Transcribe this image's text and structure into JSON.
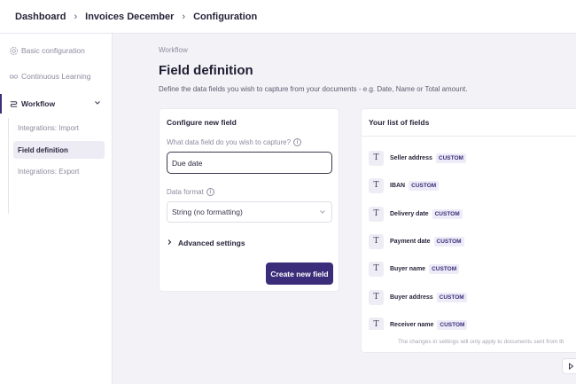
{
  "breadcrumb": [
    "Dashboard",
    "Invoices December",
    "Configuration"
  ],
  "sidebar": {
    "items": [
      {
        "label": "Basic configuration",
        "icon": "gear-icon"
      },
      {
        "label": "Continuous Learning",
        "icon": "infinity-icon"
      },
      {
        "label": "Workflow",
        "icon": "workflow-icon"
      }
    ],
    "subitems": [
      {
        "label": "Integrations: Import"
      },
      {
        "label": "Field definition",
        "active": true
      },
      {
        "label": "Integrations: Export"
      }
    ]
  },
  "main": {
    "section": "Workflow",
    "title": "Field definition",
    "description": "Define the data fields you wish to capture from your documents - e.g. Date, Name or Total amount."
  },
  "config": {
    "title": "Configure new field",
    "field_label": "What data field do you wish to capture?",
    "field_value": "Due date",
    "format_label": "Data format",
    "format_value": "String (no formatting)",
    "advanced": "Advanced settings",
    "create_button": "Create new field"
  },
  "fields_list": {
    "title": "Your list of fields",
    "badge": "CUSTOM",
    "items": [
      {
        "name": "Seller address",
        "type_icon": "T"
      },
      {
        "name": "IBAN",
        "type_icon": "T"
      },
      {
        "name": "Delivery date",
        "type_icon": "T"
      },
      {
        "name": "Payment date",
        "type_icon": "T"
      },
      {
        "name": "Buyer name",
        "type_icon": "T"
      },
      {
        "name": "Buyer address",
        "type_icon": "T"
      },
      {
        "name": "Receiver name",
        "type_icon": "T"
      }
    ],
    "note": "The changes in settings will only apply to documents sent from th"
  },
  "colors": {
    "accent": "#3b2d79",
    "badge_bg": "#edecf8",
    "active_bg": "#edecf4"
  }
}
